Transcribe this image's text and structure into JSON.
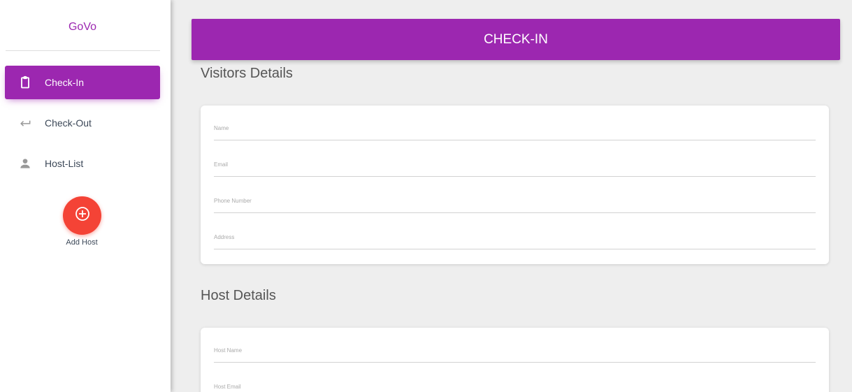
{
  "sidebar": {
    "brand": "GoVo",
    "items": [
      {
        "label": "Check-In",
        "icon": "clipboard-icon",
        "active": true
      },
      {
        "label": "Check-Out",
        "icon": "arrow-left-return-icon",
        "active": false
      },
      {
        "label": "Host-List",
        "icon": "person-icon",
        "active": false
      }
    ],
    "add_host": {
      "icon": "add-circle-icon",
      "label": "Add Host"
    }
  },
  "header": {
    "title": "CHECK-IN"
  },
  "visitors": {
    "title": "Visitors Details",
    "fields": {
      "name": "Name",
      "email": "Email",
      "phone": "Phone Number",
      "address": "Address"
    }
  },
  "host": {
    "title": "Host Details",
    "fields": {
      "name": "Host Name",
      "email": "Host Email"
    }
  },
  "colors": {
    "primary": "#9c27b0",
    "fab": "#f44336",
    "background": "#eeeeee"
  }
}
